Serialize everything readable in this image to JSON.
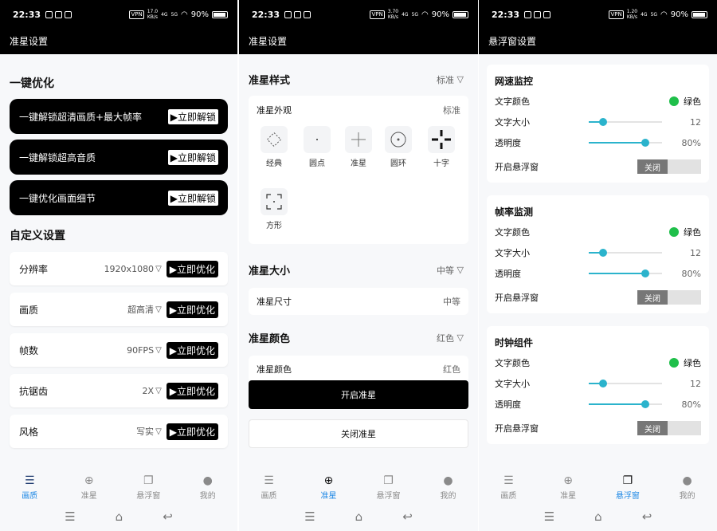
{
  "status": [
    {
      "time": "22:33",
      "speed": "17.0",
      "speed_unit": "KB/s",
      "battery": "90%"
    },
    {
      "time": "22:33",
      "speed": "3.70",
      "speed_unit": "KB/s",
      "battery": "90%"
    },
    {
      "time": "22:33",
      "speed": "1.20",
      "speed_unit": "KB/s",
      "battery": "90%"
    }
  ],
  "status_labels": {
    "vpn": "VPN",
    "net4g": "4G",
    "net5g": "5G"
  },
  "panel1": {
    "title": "准星设置",
    "one_key_title": "一键优化",
    "one_key_items": [
      {
        "label": "一键解锁超清画质+最大帧率",
        "button": "▶立即解锁"
      },
      {
        "label": "一键解锁超高音质",
        "button": "▶立即解锁"
      },
      {
        "label": "一键优化画面细节",
        "button": "▶立即解锁"
      }
    ],
    "custom_title": "自定义设置",
    "custom_items": [
      {
        "label": "分辨率",
        "value": "1920x1080",
        "button": "▶立即优化"
      },
      {
        "label": "画质",
        "value": "超高清",
        "button": "▶立即优化"
      },
      {
        "label": "帧数",
        "value": "90FPS",
        "button": "▶立即优化"
      },
      {
        "label": "抗锯齿",
        "value": "2X",
        "button": "▶立即优化"
      },
      {
        "label": "风格",
        "value": "写实",
        "button": "▶立即优化"
      }
    ]
  },
  "panel2": {
    "title": "准星设置",
    "style_title": "准星样式",
    "style_value": "标准",
    "appearance_label": "准星外观",
    "appearance_value": "标准",
    "shapes": [
      "经典",
      "圆点",
      "准星",
      "圆环",
      "十字",
      "方形"
    ],
    "size_title": "准星大小",
    "size_value": "中等",
    "size_row_label": "准星尺寸",
    "size_row_value": "中等",
    "color_title": "准星颜色",
    "color_value": "红色",
    "color_row_label": "准星颜色",
    "color_row_value": "红色",
    "open_button": "开启准星",
    "close_button": "关闭准星"
  },
  "panel3": {
    "title": "悬浮窗设置",
    "cards": [
      {
        "title": "网速监控",
        "color_label": "文字颜色",
        "color_value": "绿色",
        "size_label": "文字大小",
        "size_value": "12",
        "size_fraction": 0.2,
        "alpha_label": "透明度",
        "alpha_value": "80%",
        "alpha_fraction": 0.77,
        "toggle_label": "开启悬浮窗",
        "toggle_value": "关闭"
      },
      {
        "title": "帧率监测",
        "color_label": "文字颜色",
        "color_value": "绿色",
        "size_label": "文字大小",
        "size_value": "12",
        "size_fraction": 0.2,
        "alpha_label": "透明度",
        "alpha_value": "80%",
        "alpha_fraction": 0.77,
        "toggle_label": "开启悬浮窗",
        "toggle_value": "关闭"
      },
      {
        "title": "时钟组件",
        "color_label": "文字颜色",
        "color_value": "绿色",
        "size_label": "文字大小",
        "size_value": "12",
        "size_fraction": 0.2,
        "alpha_label": "透明度",
        "alpha_value": "80%",
        "alpha_fraction": 0.77,
        "toggle_label": "开启悬浮窗",
        "toggle_value": "关闭"
      }
    ]
  },
  "nav": [
    {
      "label": "画质",
      "icon": "sliders-icon",
      "glyph": "☰"
    },
    {
      "label": "准星",
      "icon": "crosshair-icon",
      "glyph": "⊕"
    },
    {
      "label": "悬浮窗",
      "icon": "windows-icon",
      "glyph": "❐"
    },
    {
      "label": "我的",
      "icon": "person-icon",
      "glyph": "●"
    }
  ],
  "nav_active": [
    0,
    1,
    2
  ],
  "sysnav": {
    "menu": "☰",
    "home": "⌂",
    "back": "↩"
  },
  "colors": {
    "accent_green": "#1fbf4a",
    "slider": "#2bb3cc",
    "active_blue": "#1e88e5"
  }
}
